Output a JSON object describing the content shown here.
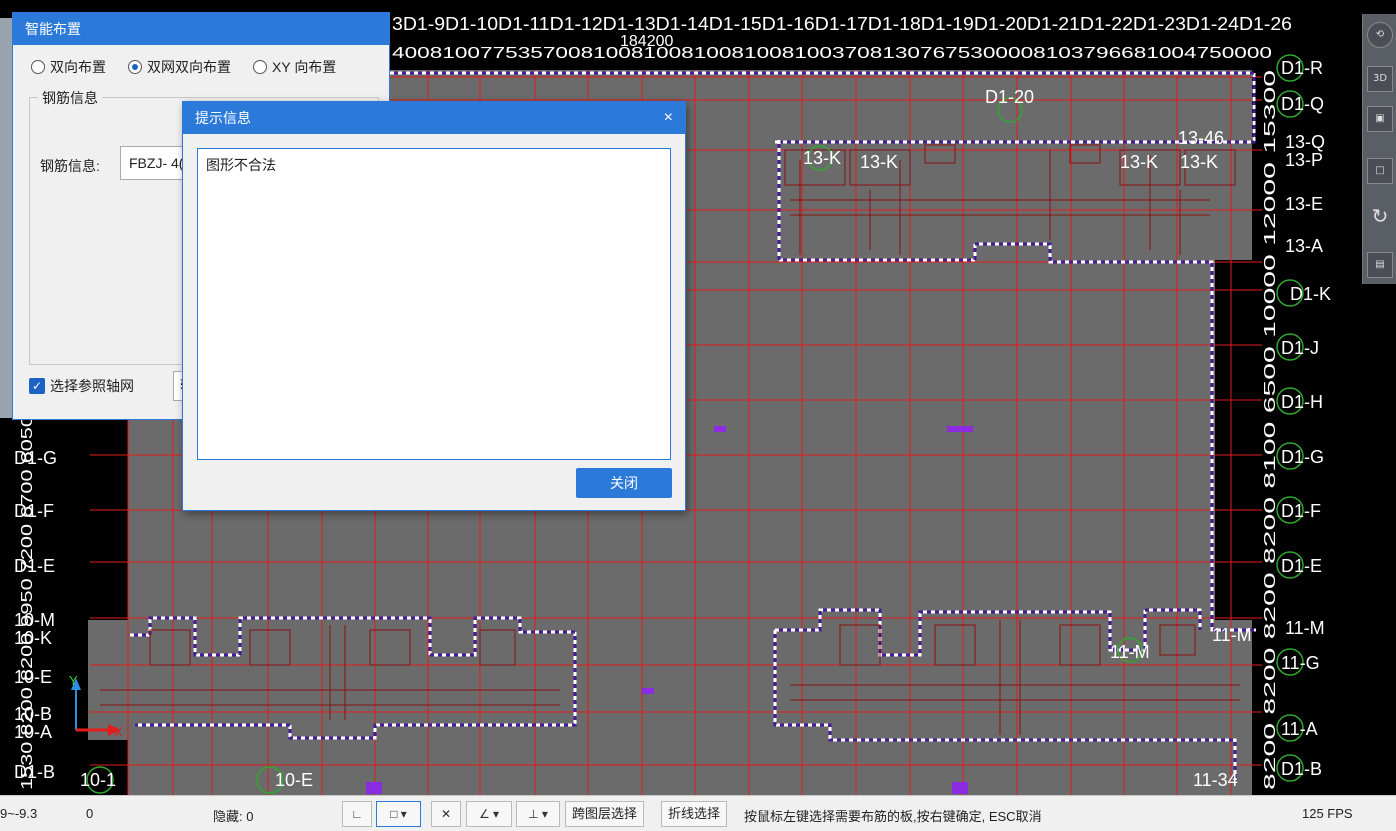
{
  "smart_layout": {
    "title": "智能布置",
    "radio_options": [
      {
        "label": "双向布置",
        "selected": false
      },
      {
        "label": "双网双向布置",
        "selected": true
      },
      {
        "label": "XY 向布置",
        "selected": false
      }
    ],
    "rebar_group_title": "钢筋信息",
    "rebar_label": "钢筋信息:",
    "rebar_value": "FBZJ- 4(",
    "ref_axis_label": "选择参照轴网",
    "ref_axis_checked": true,
    "ref_axis_value": "轴"
  },
  "message_dialog": {
    "title": "提示信息",
    "close_x": "×",
    "message": "图形不合法",
    "close_button": "关闭"
  },
  "cad": {
    "top_axis_labels": "3D1-9D1-10D1-11D1-12D1-13D1-14D1-15D1-16D1-17D1-18D1-19D1-20D1-21D1-22D1-23D1-24D1-26",
    "top_dim_labels": "4008100775357008100810081008100810037081307675300008103796681004750000",
    "top_total_dim": "184200",
    "right_axis_labels": [
      "D1-R",
      "D1-Q",
      "13-Q",
      "13-P",
      "13-E",
      "13-A",
      "D1-K",
      "D1-J",
      "D1-H",
      "D1-G",
      "D1-F",
      "D1-E",
      "11-M",
      "11-G",
      "11-A",
      "D1-B"
    ],
    "left_axis_labels": [
      "D1-G",
      "D1-F",
      "D1-E",
      "10-M",
      "10-K",
      "10-E",
      "10-B",
      "10-A",
      "D1-B"
    ],
    "left_dims": "1530 8200 8200 9950 7200 6700 6050",
    "inner_labels": [
      "D1-20",
      "13-K",
      "13-K",
      "13-K",
      "13-K",
      "13-46",
      "11-M",
      "11-M",
      "10-E",
      "10-1",
      "11-34"
    ],
    "right_dim_text": "8200 8200 8200 8200 8100 6500 10000 12000 15300",
    "ucs_y": "Y",
    "ucs_x": "X"
  },
  "view_toolbar": {
    "btn_3d": "3D"
  },
  "status_bar": {
    "coord": "9~-9.3",
    "count": "0",
    "hidden": "隐藏: 0",
    "cross_layer": "跨图层选择",
    "polyline_select": "折线选择",
    "hint": "按鼠标左键选择需要布筋的板,按右键确定, ESC取消",
    "fps": "125 FPS"
  },
  "colors": {
    "accent": "#2b79d8",
    "slab": "#6b6b6b",
    "grid_red": "#e31b1b",
    "boundary_dash": "#ffffff",
    "boundary_purple": "#4a1a9a"
  }
}
